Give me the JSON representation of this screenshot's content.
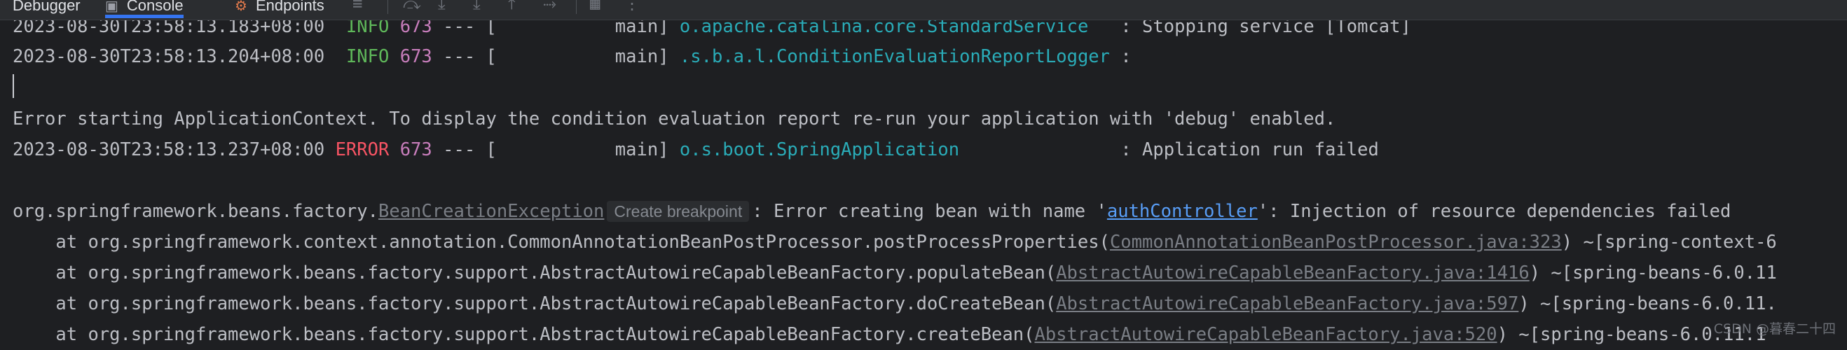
{
  "tabs": [
    {
      "label": "Debugger",
      "icon": ""
    },
    {
      "label": "Console",
      "icon": "console-icon"
    },
    {
      "label": "Endpoints",
      "icon": "endpoints-icon"
    }
  ],
  "console": {
    "lines": [
      {
        "timestamp": "2023-08-30T23:58:13.183+08:00",
        "level": "INFO",
        "pid": "673",
        "sep": " --- [",
        "thread": "           main] ",
        "logger": "o.apache.catalina.core.StandardService",
        "message": "   : Stopping service [Tomcat]"
      },
      {
        "timestamp": "2023-08-30T23:58:13.204+08:00",
        "level": "INFO",
        "pid": "673",
        "sep": " --- [",
        "thread": "           main] ",
        "logger": ".s.b.a.l.ConditionEvaluationReportLogger",
        "message": " :"
      },
      {
        "text": "Error starting ApplicationContext. To display the condition evaluation report re-run your application with 'debug' enabled."
      },
      {
        "timestamp": "2023-08-30T23:58:13.237+08:00",
        "level": "ERROR",
        "pid": "673",
        "sep": " --- [",
        "thread": "           main] ",
        "logger": "o.s.boot.SpringApplication",
        "message": "               : Application run failed"
      }
    ],
    "exception": {
      "prefix": "org.springframework.beans.factory.",
      "class_link": "BeanCreationException",
      "hint": "Create breakpoint",
      "msg_a": ": Error creating bean with name '",
      "bean_link": "authController",
      "msg_b": "': Injection of resource dependencies failed"
    },
    "stack": [
      {
        "text": "    at org.springframework.context.annotation.CommonAnnotationBeanPostProcessor.postProcessProperties(",
        "link": "CommonAnnotationBeanPostProcessor.java:323",
        "suffix": ") ~[spring-context-6"
      },
      {
        "text": "    at org.springframework.beans.factory.support.AbstractAutowireCapableBeanFactory.populateBean(",
        "link": "AbstractAutowireCapableBeanFactory.java:1416",
        "suffix": ") ~[spring-beans-6.0.11"
      },
      {
        "text": "    at org.springframework.beans.factory.support.AbstractAutowireCapableBeanFactory.doCreateBean(",
        "link": "AbstractAutowireCapableBeanFactory.java:597",
        "suffix": ") ~[spring-beans-6.0.11."
      },
      {
        "text": "    at org.springframework.beans.factory.support.AbstractAutowireCapableBeanFactory.createBean(",
        "link": "AbstractAutowireCapableBeanFactory.java:520",
        "suffix": ") ~[spring-beans-6.0.11.1"
      }
    ]
  },
  "watermark": "CSDN @暮春二十四"
}
